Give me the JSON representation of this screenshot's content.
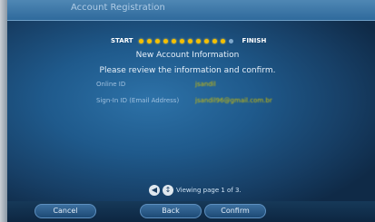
{
  "header": {
    "title": "Account Registration"
  },
  "progress": {
    "start_label": "START",
    "finish_label": "FINISH",
    "total_steps": 12,
    "completed_steps": 11
  },
  "main": {
    "heading": "New Account Information",
    "instruction": "Please review the information and confirm.",
    "fields": [
      {
        "label": "Online ID",
        "value": "jsandil"
      },
      {
        "label": "Sign-In ID (Email Address)",
        "value": "jsandil96@gmail.com.br"
      }
    ]
  },
  "pager": {
    "text": "Viewing page 1 of 3."
  },
  "buttons": {
    "cancel": "Cancel",
    "back": "Back",
    "confirm": "Confirm"
  },
  "colors": {
    "progress_dot": "#f5c000",
    "field_value": "#d4c100"
  }
}
